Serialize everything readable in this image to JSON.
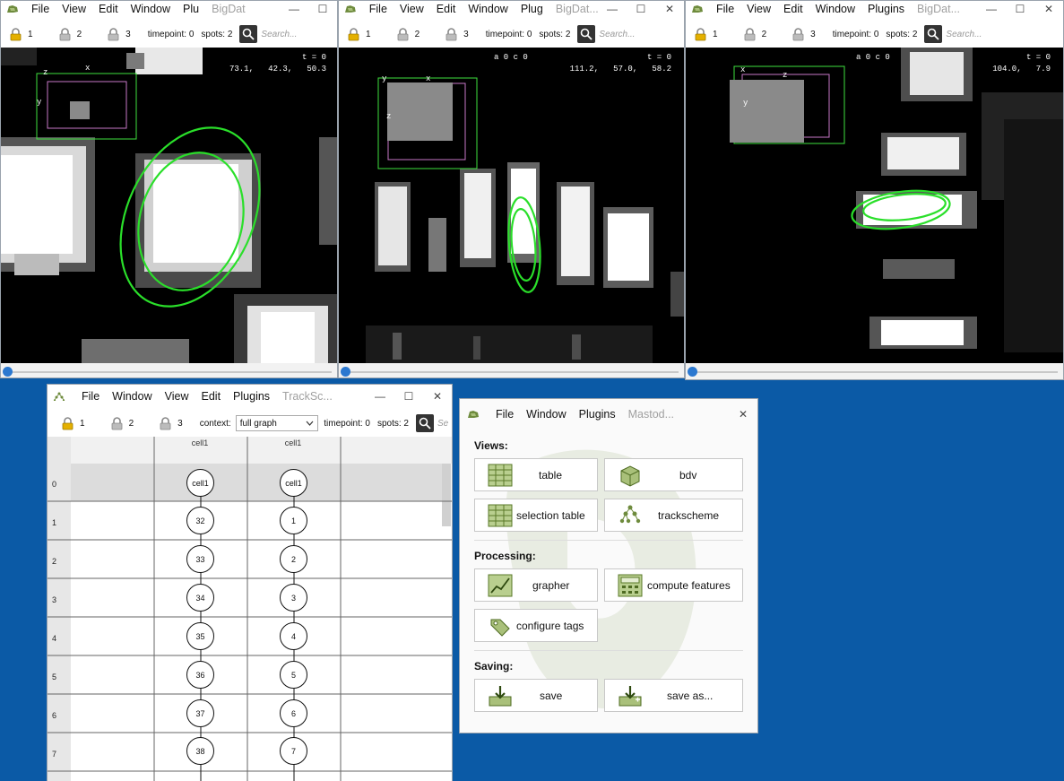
{
  "bdv_windows": [
    {
      "menu": [
        "File",
        "View",
        "Edit",
        "Window",
        "Plu"
      ],
      "title": "BigDat",
      "controls": [
        "—",
        "☐",
        "✕"
      ],
      "locks": [
        "1",
        "2",
        "3"
      ],
      "timepoint": "timepoint: 0",
      "spots": "spots: 2",
      "search_placeholder": "Search...",
      "overlay_time": "t = 0",
      "overlay_coords": "73.1,   42.3,   50.3",
      "overlay_source": "",
      "axes": {
        "a": "z",
        "b": "x",
        "c": "y"
      }
    },
    {
      "menu": [
        "File",
        "View",
        "Edit",
        "Window",
        "Plug"
      ],
      "title": "BigDat...",
      "controls": [
        "—",
        "☐",
        "✕"
      ],
      "locks": [
        "1",
        "2",
        "3"
      ],
      "timepoint": "timepoint: 0",
      "spots": "spots: 2",
      "search_placeholder": "Search...",
      "overlay_time": "t = 0",
      "overlay_coords": "111.2,   57.0,   58.2",
      "overlay_source": "a 0 c 0",
      "axes": {
        "a": "y",
        "b": "x",
        "c": "z"
      }
    },
    {
      "menu": [
        "File",
        "View",
        "Edit",
        "Window",
        "Plugins"
      ],
      "title": "BigDat...",
      "controls": [
        "—",
        "☐",
        "✕"
      ],
      "locks": [
        "1",
        "2",
        "3"
      ],
      "timepoint": "timepoint: 0",
      "spots": "spots: 2",
      "search_placeholder": "Search...",
      "overlay_time": "t = 0",
      "overlay_coords": "104.0,   7.9",
      "overlay_source": "a 0 c 0",
      "axes": {
        "a": "x",
        "b": "z",
        "c": "y"
      }
    }
  ],
  "trackscheme": {
    "menu": [
      "File",
      "Window",
      "View",
      "Edit",
      "Plugins"
    ],
    "title": "TrackSc...",
    "controls": [
      "—",
      "☐",
      "✕"
    ],
    "locks": [
      "1",
      "2",
      "3"
    ],
    "context_label": "context:",
    "context_value": "full graph",
    "timepoint": "timepoint: 0",
    "spots": "spots: 2",
    "search_placeholder": "Se",
    "columns": [
      "cell1",
      "cell1"
    ],
    "rows": [
      "0",
      "1",
      "2",
      "3",
      "4",
      "5",
      "6",
      "7"
    ],
    "track1": [
      "cell1",
      "32",
      "33",
      "34",
      "35",
      "36",
      "37",
      "38"
    ],
    "track2": [
      "cell1",
      "1",
      "2",
      "3",
      "4",
      "5",
      "6",
      "7"
    ]
  },
  "mastodon": {
    "menu": [
      "File",
      "Window",
      "Plugins"
    ],
    "title": "Mastod...",
    "close": "✕",
    "sections": {
      "views": "Views:",
      "processing": "Processing:",
      "saving": "Saving:"
    },
    "buttons": {
      "table": "table",
      "bdv": "bdv",
      "selection_table": "selection table",
      "trackscheme": "trackscheme",
      "grapher": "grapher",
      "compute_features": "compute features",
      "configure_tags": "configure tags",
      "save": "save",
      "save_as": "save as..."
    }
  },
  "colors": {
    "desktop": "#0b5aa6",
    "ellipse": "#2adf2a",
    "box_outer": "#3ee03e",
    "box_inner": "#c878c8",
    "accent": "#2b78d0",
    "icon_green": "#6e8b3d"
  }
}
